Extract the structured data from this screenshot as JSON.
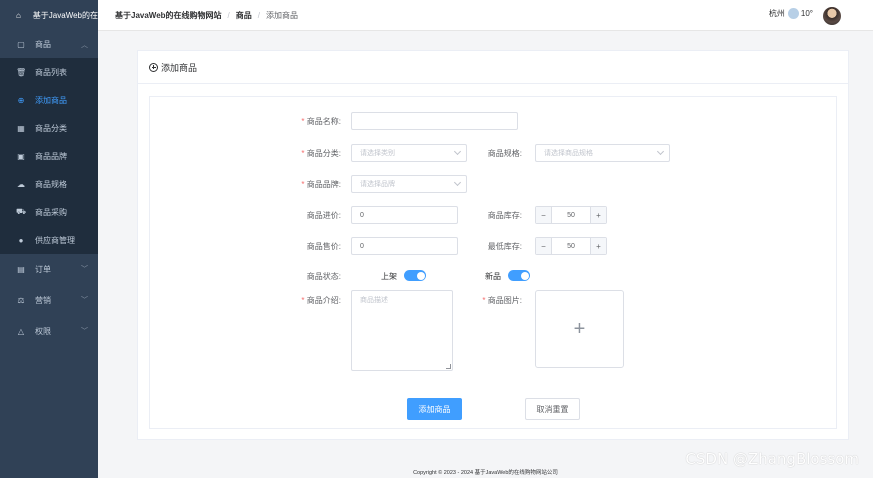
{
  "sidebar": {
    "logo_text": "基于JavaWeb的在",
    "menu": {
      "goods": {
        "label": "商品",
        "icon": "bag-icon"
      },
      "goods_list": {
        "label": "商品列表",
        "icon": "trash-icon"
      },
      "add_goods": {
        "label": "添加商品",
        "icon": "plus-circle-icon"
      },
      "goods_category": {
        "label": "商品分类",
        "icon": "grid-icon"
      },
      "goods_brand": {
        "label": "商品品牌",
        "icon": "clipboard-icon"
      },
      "goods_spec": {
        "label": "商品规格",
        "icon": "cloud-icon"
      },
      "goods_purchase": {
        "label": "商品采购",
        "icon": "truck-icon"
      },
      "supplier": {
        "label": "供应商管理",
        "icon": "user-icon"
      },
      "orders": {
        "label": "订单",
        "icon": "calendar-icon"
      },
      "marketing": {
        "label": "营销",
        "icon": "scale-icon"
      },
      "permission": {
        "label": "权限",
        "icon": "bell-icon"
      }
    }
  },
  "header": {
    "breadcrumb": [
      "基于JavaWeb的在线购物网站",
      "商品",
      "添加商品"
    ],
    "city": "杭州",
    "temperature": "10°"
  },
  "card": {
    "title": "添加商品"
  },
  "form": {
    "name": {
      "label": "商品名称:",
      "value": ""
    },
    "category": {
      "label": "商品分类:",
      "placeholder": "请选择类别"
    },
    "spec": {
      "label": "商品规格:",
      "placeholder": "请选择商品规格"
    },
    "brand": {
      "label": "商品品牌:",
      "placeholder": "请选择品牌"
    },
    "purchase_price": {
      "label": "商品进价:",
      "value": "0"
    },
    "stock": {
      "label": "商品库存:",
      "value": "50"
    },
    "sale_price": {
      "label": "商品售价:",
      "value": "0"
    },
    "min_stock": {
      "label": "最低库存:",
      "value": "50"
    },
    "status": {
      "label": "商品状态:",
      "on_text": "上架",
      "on": true
    },
    "new": {
      "label": "新品",
      "on": true
    },
    "intro": {
      "label": "商品介绍:",
      "placeholder": "商品描述"
    },
    "image": {
      "label": "商品图片:"
    },
    "submit_label": "添加商品",
    "reset_label": "取消重置"
  },
  "footer": "Copyright © 2023 - 2024   基于JavaWeb的在线购物网站公司",
  "watermark": "CSDN @ZhangBlossom",
  "colors": {
    "primary": "#409eff",
    "sidebar_bg": "#304156",
    "sidebar_sub_bg": "#1f2d3d",
    "required": "#f56c6c"
  }
}
